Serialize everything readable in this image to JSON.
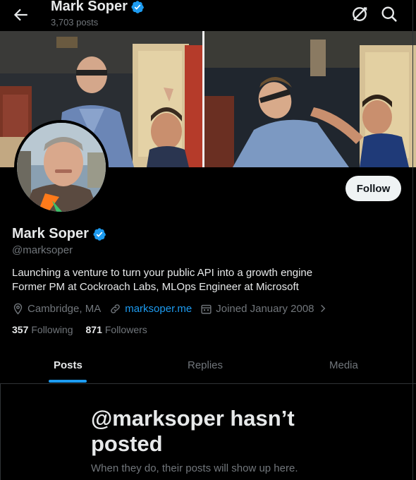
{
  "header": {
    "name": "Mark Soper",
    "posts_count": "3,703 posts"
  },
  "profile": {
    "name": "Mark Soper",
    "handle": "@marksoper",
    "bio_line1": "Launching a venture to turn your public API into a growth engine",
    "bio_line2": "Former PM at Cockroach Labs, MLOps Engineer at Microsoft",
    "location": "Cambridge, MA",
    "website": "marksoper.me",
    "joined": "Joined January 2008",
    "following_count": "357",
    "following_label": "Following",
    "followers_count": "871",
    "followers_label": "Followers",
    "follow_button": "Follow"
  },
  "tabs": [
    {
      "label": "Posts",
      "active": true
    },
    {
      "label": "Replies",
      "active": false
    },
    {
      "label": "Media",
      "active": false
    }
  ],
  "empty_state": {
    "title": "@marksoper hasn’t posted",
    "subtitle": "When they do, their posts will show up here."
  },
  "icons": {
    "back": "arrow-left-icon",
    "grok": "grok-icon",
    "search": "search-icon",
    "verified": "verified-badge-icon",
    "location": "location-pin-icon",
    "link": "link-icon",
    "calendar": "calendar-icon",
    "chevron": "chevron-right-icon"
  },
  "colors": {
    "background": "#000000",
    "accent": "#1d9bf0",
    "text_primary": "#e7e9ea",
    "text_secondary": "#71767b",
    "follow_bg": "#eff3f4"
  }
}
